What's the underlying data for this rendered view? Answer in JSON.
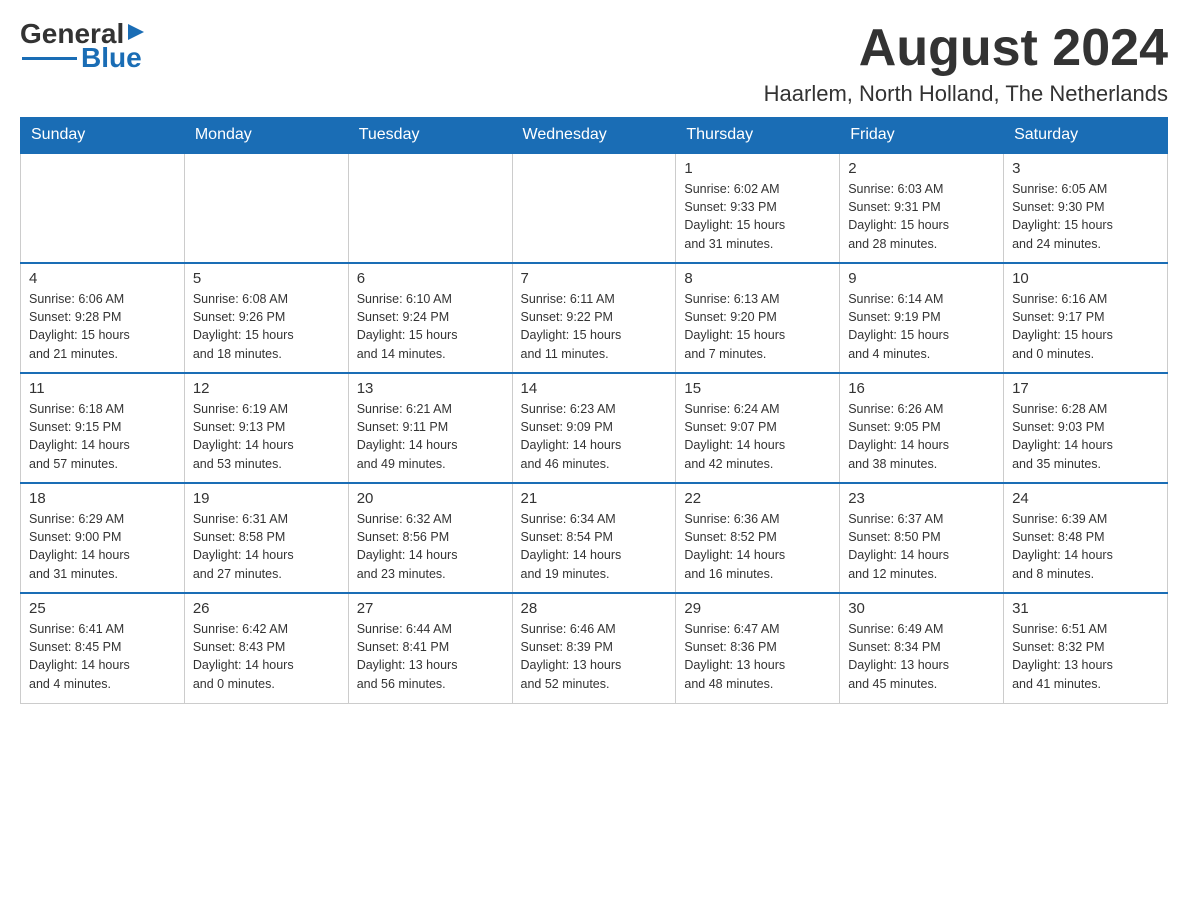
{
  "logo": {
    "text_general": "General",
    "text_blue": "Blue"
  },
  "title": "August 2024",
  "location": "Haarlem, North Holland, The Netherlands",
  "weekdays": [
    "Sunday",
    "Monday",
    "Tuesday",
    "Wednesday",
    "Thursday",
    "Friday",
    "Saturday"
  ],
  "weeks": [
    [
      {
        "day": "",
        "info": ""
      },
      {
        "day": "",
        "info": ""
      },
      {
        "day": "",
        "info": ""
      },
      {
        "day": "",
        "info": ""
      },
      {
        "day": "1",
        "info": "Sunrise: 6:02 AM\nSunset: 9:33 PM\nDaylight: 15 hours\nand 31 minutes."
      },
      {
        "day": "2",
        "info": "Sunrise: 6:03 AM\nSunset: 9:31 PM\nDaylight: 15 hours\nand 28 minutes."
      },
      {
        "day": "3",
        "info": "Sunrise: 6:05 AM\nSunset: 9:30 PM\nDaylight: 15 hours\nand 24 minutes."
      }
    ],
    [
      {
        "day": "4",
        "info": "Sunrise: 6:06 AM\nSunset: 9:28 PM\nDaylight: 15 hours\nand 21 minutes."
      },
      {
        "day": "5",
        "info": "Sunrise: 6:08 AM\nSunset: 9:26 PM\nDaylight: 15 hours\nand 18 minutes."
      },
      {
        "day": "6",
        "info": "Sunrise: 6:10 AM\nSunset: 9:24 PM\nDaylight: 15 hours\nand 14 minutes."
      },
      {
        "day": "7",
        "info": "Sunrise: 6:11 AM\nSunset: 9:22 PM\nDaylight: 15 hours\nand 11 minutes."
      },
      {
        "day": "8",
        "info": "Sunrise: 6:13 AM\nSunset: 9:20 PM\nDaylight: 15 hours\nand 7 minutes."
      },
      {
        "day": "9",
        "info": "Sunrise: 6:14 AM\nSunset: 9:19 PM\nDaylight: 15 hours\nand 4 minutes."
      },
      {
        "day": "10",
        "info": "Sunrise: 6:16 AM\nSunset: 9:17 PM\nDaylight: 15 hours\nand 0 minutes."
      }
    ],
    [
      {
        "day": "11",
        "info": "Sunrise: 6:18 AM\nSunset: 9:15 PM\nDaylight: 14 hours\nand 57 minutes."
      },
      {
        "day": "12",
        "info": "Sunrise: 6:19 AM\nSunset: 9:13 PM\nDaylight: 14 hours\nand 53 minutes."
      },
      {
        "day": "13",
        "info": "Sunrise: 6:21 AM\nSunset: 9:11 PM\nDaylight: 14 hours\nand 49 minutes."
      },
      {
        "day": "14",
        "info": "Sunrise: 6:23 AM\nSunset: 9:09 PM\nDaylight: 14 hours\nand 46 minutes."
      },
      {
        "day": "15",
        "info": "Sunrise: 6:24 AM\nSunset: 9:07 PM\nDaylight: 14 hours\nand 42 minutes."
      },
      {
        "day": "16",
        "info": "Sunrise: 6:26 AM\nSunset: 9:05 PM\nDaylight: 14 hours\nand 38 minutes."
      },
      {
        "day": "17",
        "info": "Sunrise: 6:28 AM\nSunset: 9:03 PM\nDaylight: 14 hours\nand 35 minutes."
      }
    ],
    [
      {
        "day": "18",
        "info": "Sunrise: 6:29 AM\nSunset: 9:00 PM\nDaylight: 14 hours\nand 31 minutes."
      },
      {
        "day": "19",
        "info": "Sunrise: 6:31 AM\nSunset: 8:58 PM\nDaylight: 14 hours\nand 27 minutes."
      },
      {
        "day": "20",
        "info": "Sunrise: 6:32 AM\nSunset: 8:56 PM\nDaylight: 14 hours\nand 23 minutes."
      },
      {
        "day": "21",
        "info": "Sunrise: 6:34 AM\nSunset: 8:54 PM\nDaylight: 14 hours\nand 19 minutes."
      },
      {
        "day": "22",
        "info": "Sunrise: 6:36 AM\nSunset: 8:52 PM\nDaylight: 14 hours\nand 16 minutes."
      },
      {
        "day": "23",
        "info": "Sunrise: 6:37 AM\nSunset: 8:50 PM\nDaylight: 14 hours\nand 12 minutes."
      },
      {
        "day": "24",
        "info": "Sunrise: 6:39 AM\nSunset: 8:48 PM\nDaylight: 14 hours\nand 8 minutes."
      }
    ],
    [
      {
        "day": "25",
        "info": "Sunrise: 6:41 AM\nSunset: 8:45 PM\nDaylight: 14 hours\nand 4 minutes."
      },
      {
        "day": "26",
        "info": "Sunrise: 6:42 AM\nSunset: 8:43 PM\nDaylight: 14 hours\nand 0 minutes."
      },
      {
        "day": "27",
        "info": "Sunrise: 6:44 AM\nSunset: 8:41 PM\nDaylight: 13 hours\nand 56 minutes."
      },
      {
        "day": "28",
        "info": "Sunrise: 6:46 AM\nSunset: 8:39 PM\nDaylight: 13 hours\nand 52 minutes."
      },
      {
        "day": "29",
        "info": "Sunrise: 6:47 AM\nSunset: 8:36 PM\nDaylight: 13 hours\nand 48 minutes."
      },
      {
        "day": "30",
        "info": "Sunrise: 6:49 AM\nSunset: 8:34 PM\nDaylight: 13 hours\nand 45 minutes."
      },
      {
        "day": "31",
        "info": "Sunrise: 6:51 AM\nSunset: 8:32 PM\nDaylight: 13 hours\nand 41 minutes."
      }
    ]
  ]
}
